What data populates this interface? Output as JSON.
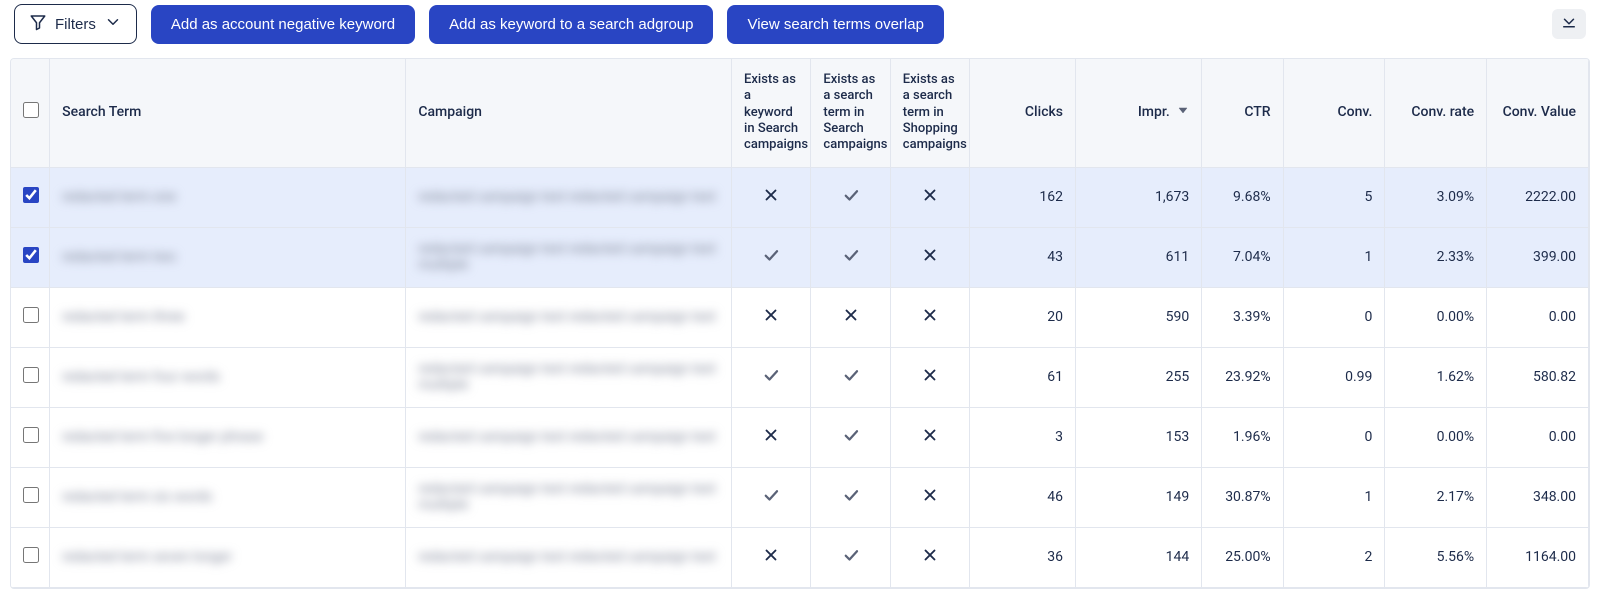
{
  "toolbar": {
    "filters_label": "Filters",
    "add_negative_label": "Add as account negative keyword",
    "add_keyword_label": "Add as keyword to a search adgroup",
    "view_overlap_label": "View search terms overlap"
  },
  "table": {
    "headers": {
      "search_term": "Search Term",
      "campaign": "Campaign",
      "exists_keyword_search": "Exists as a keyword in Search campaigns",
      "exists_term_search": "Exists as a search term in Search campaigns",
      "exists_term_shopping": "Exists as a search term in Shopping campaigns",
      "clicks": "Clicks",
      "impr": "Impr.",
      "ctr": "CTR",
      "conv": "Conv.",
      "conv_rate": "Conv. rate",
      "conv_value": "Conv. Value"
    },
    "sort": {
      "column": "impr",
      "dir": "desc"
    },
    "rows": [
      {
        "checked": true,
        "term": "redacted term one",
        "campaign": "redacted campaign text redacted campaign text",
        "kw_search": false,
        "st_search": true,
        "st_shop": false,
        "clicks": "162",
        "impr": "1,673",
        "ctr": "9.68%",
        "conv": "5",
        "conv_rate": "3.09%",
        "conv_value": "2222.00"
      },
      {
        "checked": true,
        "term": "redacted term two",
        "campaign": "redacted campaign text redacted campaign text multiple",
        "kw_search": true,
        "st_search": true,
        "st_shop": false,
        "clicks": "43",
        "impr": "611",
        "ctr": "7.04%",
        "conv": "1",
        "conv_rate": "2.33%",
        "conv_value": "399.00"
      },
      {
        "checked": false,
        "term": "redacted term three",
        "campaign": "redacted campaign text redacted campaign text",
        "kw_search": false,
        "st_search": false,
        "st_shop": false,
        "clicks": "20",
        "impr": "590",
        "ctr": "3.39%",
        "conv": "0",
        "conv_rate": "0.00%",
        "conv_value": "0.00"
      },
      {
        "checked": false,
        "term": "redacted term four words",
        "campaign": "redacted campaign text redacted campaign text multiple",
        "kw_search": true,
        "st_search": true,
        "st_shop": false,
        "clicks": "61",
        "impr": "255",
        "ctr": "23.92%",
        "conv": "0.99",
        "conv_rate": "1.62%",
        "conv_value": "580.82"
      },
      {
        "checked": false,
        "term": "redacted term five longer phrase",
        "campaign": "redacted campaign text redacted campaign text",
        "kw_search": false,
        "st_search": true,
        "st_shop": false,
        "clicks": "3",
        "impr": "153",
        "ctr": "1.96%",
        "conv": "0",
        "conv_rate": "0.00%",
        "conv_value": "0.00"
      },
      {
        "checked": false,
        "term": "redacted term six words",
        "campaign": "redacted campaign text redacted campaign text multiple",
        "kw_search": true,
        "st_search": true,
        "st_shop": false,
        "clicks": "46",
        "impr": "149",
        "ctr": "30.87%",
        "conv": "1",
        "conv_rate": "2.17%",
        "conv_value": "348.00"
      },
      {
        "checked": false,
        "term": "redacted term seven longer",
        "campaign": "redacted campaign text redacted campaign text",
        "kw_search": false,
        "st_search": true,
        "st_shop": false,
        "clicks": "36",
        "impr": "144",
        "ctr": "25.00%",
        "conv": "2",
        "conv_rate": "5.56%",
        "conv_value": "1164.00"
      }
    ]
  }
}
